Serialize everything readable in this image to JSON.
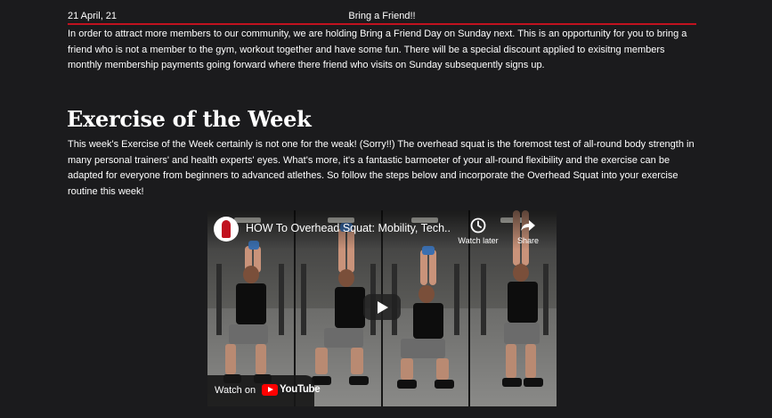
{
  "news": {
    "date": "21 April, 21",
    "title": "Bring a Friend!!",
    "body": "In order to attract more members to our community, we are holding Bring a Friend Day on Sunday next. This is an opportunity for you to bring a friend who is not a member to the gym, workout together and have some fun. There will be a special discount applied to exisitng members monthly membership payments going forward where there friend who visits on Sunday subsequently signs up."
  },
  "exercise": {
    "heading": "Exercise of the Week",
    "body": "This week's Exercise of the Week certainly is not one for the weak! (Sorry!!) The overhead squat is the foremost test of all-round body strength in many personal trainers' and health experts' eyes. What's more, it's a fantastic barmoeter of your all-round flexibility and the exercise can be adapted for everyone from beginners to advanced atlethes. So follow the steps below and incorporate the Overhead Squat into your exercise routine this week!"
  },
  "video": {
    "title": "HOW To Overhead Squat: Mobility, Tech...",
    "watch_later_label": "Watch later",
    "share_label": "Share",
    "watch_on_label": "Watch on",
    "youtube_label": "YouTube",
    "icons": {
      "watch_later": "clock-icon",
      "share": "share-arrow-icon",
      "play": "play-icon",
      "channel": "channel-avatar"
    },
    "colors": {
      "youtube_red": "#ff0000",
      "header_rule": "#c1121f"
    }
  }
}
